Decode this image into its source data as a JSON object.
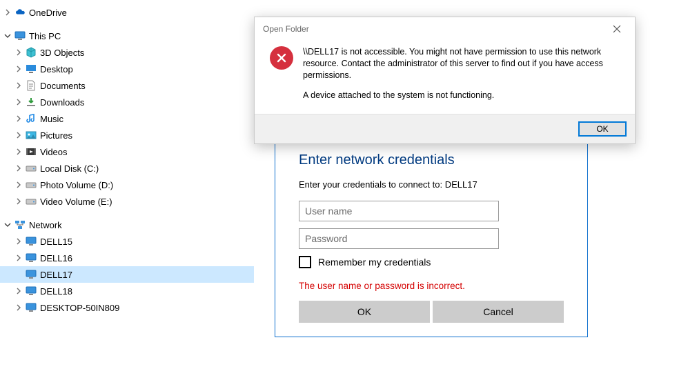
{
  "tree": {
    "onedrive": "OneDrive",
    "thispc": "This PC",
    "thispc_children": {
      "objects3d": "3D Objects",
      "desktop": "Desktop",
      "documents": "Documents",
      "downloads": "Downloads",
      "music": "Music",
      "pictures": "Pictures",
      "videos": "Videos",
      "localdisk": "Local Disk (C:)",
      "photovol": "Photo Volume (D:)",
      "videovol": "Video Volume (E:)"
    },
    "network": "Network",
    "network_children": {
      "dell15": "DELL15",
      "dell16": "DELL16",
      "dell17": "DELL17",
      "dell18": "DELL18",
      "desktop50": "DESKTOP-50IN809"
    }
  },
  "cred": {
    "title": "Enter network credentials",
    "instr": "Enter your credentials to connect to: DELL17",
    "user_ph": "User name",
    "pass_ph": "Password",
    "remember": "Remember my credentials",
    "error": "The user name or password is incorrect.",
    "ok": "OK",
    "cancel": "Cancel"
  },
  "dlg": {
    "title": "Open Folder",
    "line1": "\\\\DELL17 is not accessible. You might not have permission to use this network resource. Contact the administrator of this server to find out if you have access permissions.",
    "line2": "A device attached to the system is not functioning.",
    "ok": "OK"
  }
}
